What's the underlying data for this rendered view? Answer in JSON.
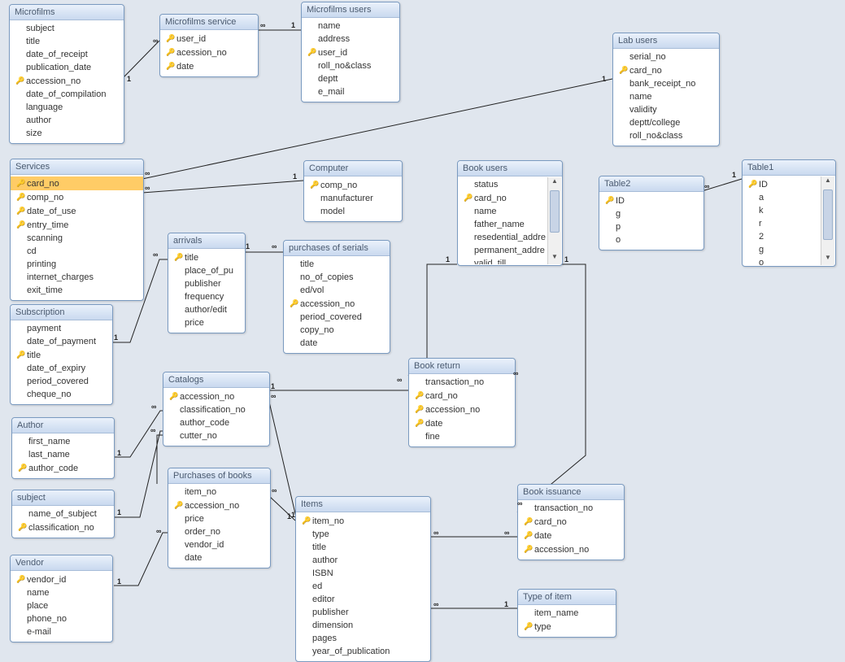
{
  "tables": {
    "microfilms": {
      "title": "Microfilms",
      "fields": [
        {
          "name": "subject",
          "pk": false
        },
        {
          "name": "title",
          "pk": false
        },
        {
          "name": "date_of_receipt",
          "pk": false
        },
        {
          "name": "publication_date",
          "pk": false
        },
        {
          "name": "accession_no",
          "pk": true
        },
        {
          "name": "date_of_compilation",
          "pk": false
        },
        {
          "name": "language",
          "pk": false
        },
        {
          "name": "author",
          "pk": false
        },
        {
          "name": "size",
          "pk": false
        }
      ]
    },
    "microfilms_service": {
      "title": "Microfilms service",
      "fields": [
        {
          "name": "user_id",
          "pk": true
        },
        {
          "name": "acession_no",
          "pk": true
        },
        {
          "name": "date",
          "pk": true
        }
      ]
    },
    "microfilms_users": {
      "title": "Microfilms users",
      "fields": [
        {
          "name": "name",
          "pk": false
        },
        {
          "name": "address",
          "pk": false
        },
        {
          "name": "user_id",
          "pk": true
        },
        {
          "name": "roll_no&class",
          "pk": false
        },
        {
          "name": "deptt",
          "pk": false
        },
        {
          "name": "e_mail",
          "pk": false
        }
      ]
    },
    "lab_users": {
      "title": "Lab users",
      "fields": [
        {
          "name": "serial_no",
          "pk": false
        },
        {
          "name": "card_no",
          "pk": true
        },
        {
          "name": "bank_receipt_no",
          "pk": false
        },
        {
          "name": "name",
          "pk": false
        },
        {
          "name": "validity",
          "pk": false
        },
        {
          "name": "deptt/college",
          "pk": false
        },
        {
          "name": "roll_no&class",
          "pk": false
        }
      ]
    },
    "services": {
      "title": "Services",
      "fields": [
        {
          "name": "card_no",
          "pk": true,
          "selected": true
        },
        {
          "name": "comp_no",
          "pk": true
        },
        {
          "name": "date_of_use",
          "pk": true
        },
        {
          "name": "entry_time",
          "pk": true
        },
        {
          "name": "scanning",
          "pk": false
        },
        {
          "name": "cd",
          "pk": false
        },
        {
          "name": "printing",
          "pk": false
        },
        {
          "name": "internet_charges",
          "pk": false
        },
        {
          "name": "exit_time",
          "pk": false
        }
      ]
    },
    "computer": {
      "title": "Computer",
      "fields": [
        {
          "name": "comp_no",
          "pk": true
        },
        {
          "name": "manufacturer",
          "pk": false
        },
        {
          "name": "model",
          "pk": false
        }
      ]
    },
    "book_users": {
      "title": "Book users",
      "fields": [
        {
          "name": "status",
          "pk": false
        },
        {
          "name": "card_no",
          "pk": true
        },
        {
          "name": "name",
          "pk": false
        },
        {
          "name": "father_name",
          "pk": false
        },
        {
          "name": "resedential_addre",
          "pk": false
        },
        {
          "name": "permanent_addre",
          "pk": false
        },
        {
          "name": "valid_till",
          "pk": false
        }
      ]
    },
    "table2": {
      "title": "Table2",
      "fields": [
        {
          "name": "ID",
          "pk": true
        },
        {
          "name": "g",
          "pk": false
        },
        {
          "name": "p",
          "pk": false
        },
        {
          "name": "o",
          "pk": false
        }
      ]
    },
    "table1": {
      "title": "Table1",
      "fields": [
        {
          "name": "ID",
          "pk": true
        },
        {
          "name": "a",
          "pk": false
        },
        {
          "name": "k",
          "pk": false
        },
        {
          "name": "r",
          "pk": false
        },
        {
          "name": "2",
          "pk": false
        },
        {
          "name": "g",
          "pk": false
        },
        {
          "name": "o",
          "pk": false
        }
      ]
    },
    "arrivals": {
      "title": "arrivals",
      "fields": [
        {
          "name": "title",
          "pk": true
        },
        {
          "name": "place_of_pu",
          "pk": false
        },
        {
          "name": "publisher",
          "pk": false
        },
        {
          "name": "frequency",
          "pk": false
        },
        {
          "name": "author/edit",
          "pk": false
        },
        {
          "name": "price",
          "pk": false
        }
      ]
    },
    "purchases_serials": {
      "title": "purchases of serials",
      "fields": [
        {
          "name": "title",
          "pk": false
        },
        {
          "name": "no_of_copies",
          "pk": false
        },
        {
          "name": "ed/vol",
          "pk": false
        },
        {
          "name": "accession_no",
          "pk": true
        },
        {
          "name": "period_covered",
          "pk": false
        },
        {
          "name": "copy_no",
          "pk": false
        },
        {
          "name": "date",
          "pk": false
        }
      ]
    },
    "subscription": {
      "title": "Subscription",
      "fields": [
        {
          "name": "payment",
          "pk": false
        },
        {
          "name": "date_of_payment",
          "pk": false
        },
        {
          "name": "title",
          "pk": true
        },
        {
          "name": "date_of_expiry",
          "pk": false
        },
        {
          "name": "period_covered",
          "pk": false
        },
        {
          "name": "cheque_no",
          "pk": false
        }
      ]
    },
    "book_return": {
      "title": "Book return",
      "fields": [
        {
          "name": "transaction_no",
          "pk": false
        },
        {
          "name": "card_no",
          "pk": true
        },
        {
          "name": "accession_no",
          "pk": true
        },
        {
          "name": "date",
          "pk": true
        },
        {
          "name": "fine",
          "pk": false
        }
      ]
    },
    "catalogs": {
      "title": "Catalogs",
      "fields": [
        {
          "name": "accession_no",
          "pk": true
        },
        {
          "name": "classification_no",
          "pk": false
        },
        {
          "name": "author_code",
          "pk": false
        },
        {
          "name": "cutter_no",
          "pk": false
        }
      ]
    },
    "author": {
      "title": "Author",
      "fields": [
        {
          "name": "first_name",
          "pk": false
        },
        {
          "name": "last_name",
          "pk": false
        },
        {
          "name": "author_code",
          "pk": true
        }
      ]
    },
    "subject": {
      "title": "subject",
      "fields": [
        {
          "name": "name_of_subject",
          "pk": false
        },
        {
          "name": "classification_no",
          "pk": true
        }
      ]
    },
    "purchases_books": {
      "title": "Purchases of books",
      "fields": [
        {
          "name": "item_no",
          "pk": false
        },
        {
          "name": "accession_no",
          "pk": true
        },
        {
          "name": "price",
          "pk": false
        },
        {
          "name": "order_no",
          "pk": false
        },
        {
          "name": "vendor_id",
          "pk": false
        },
        {
          "name": "date",
          "pk": false
        }
      ]
    },
    "items": {
      "title": "Items",
      "fields": [
        {
          "name": "item_no",
          "pk": true
        },
        {
          "name": "type",
          "pk": false
        },
        {
          "name": "title",
          "pk": false
        },
        {
          "name": "author",
          "pk": false
        },
        {
          "name": "ISBN",
          "pk": false
        },
        {
          "name": "ed",
          "pk": false
        },
        {
          "name": "editor",
          "pk": false
        },
        {
          "name": "publisher",
          "pk": false
        },
        {
          "name": "dimension",
          "pk": false
        },
        {
          "name": "pages",
          "pk": false
        },
        {
          "name": "year_of_publication",
          "pk": false
        }
      ]
    },
    "book_issuance": {
      "title": "Book issuance",
      "fields": [
        {
          "name": "transaction_no",
          "pk": false
        },
        {
          "name": "card_no",
          "pk": true
        },
        {
          "name": "date",
          "pk": true
        },
        {
          "name": "accession_no",
          "pk": true
        }
      ]
    },
    "vendor": {
      "title": "Vendor",
      "fields": [
        {
          "name": "vendor_id",
          "pk": true
        },
        {
          "name": "name",
          "pk": false
        },
        {
          "name": "place",
          "pk": false
        },
        {
          "name": "phone_no",
          "pk": false
        },
        {
          "name": "e-mail",
          "pk": false
        }
      ]
    },
    "type_item": {
      "title": "Type of item",
      "fields": [
        {
          "name": "item_name",
          "pk": false
        },
        {
          "name": "type",
          "pk": true
        }
      ]
    }
  },
  "cardinality": {
    "one": "1",
    "many": "∞"
  }
}
